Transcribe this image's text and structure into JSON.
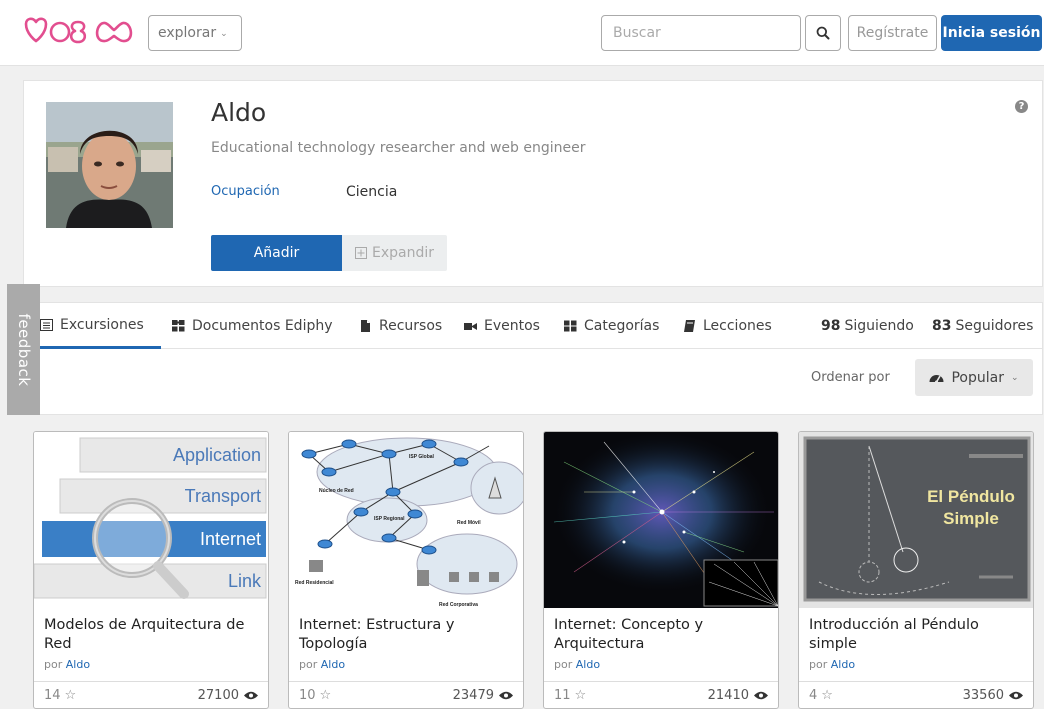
{
  "header": {
    "explore_label": "explorar",
    "search_placeholder": "Buscar",
    "register_label": "Regístrate",
    "login_label": "Inicia sesión",
    "brand_color": "#1f67b2",
    "logo_color": "#e24e8f"
  },
  "profile": {
    "name": "Aldo",
    "description": "Educational technology researcher and web engineer",
    "occupation_label": "Ocupación",
    "occupation_value": "Ciencia",
    "add_label": "Añadir",
    "expand_label": "Expandir"
  },
  "tabs": [
    {
      "label": "Excursiones",
      "icon": "list-icon",
      "active": true
    },
    {
      "label": "Documentos Ediphy",
      "icon": "puzzle-icon",
      "active": false
    },
    {
      "label": "Recursos",
      "icon": "file-icon",
      "active": false
    },
    {
      "label": "Eventos",
      "icon": "video-icon",
      "active": false
    },
    {
      "label": "Categorías",
      "icon": "grid-icon",
      "active": false
    },
    {
      "label": "Lecciones",
      "icon": "book-icon",
      "active": false
    }
  ],
  "stats": {
    "following_count": "98",
    "following_label": "Siguiendo",
    "followers_count": "83",
    "followers_label": "Seguidores"
  },
  "sort": {
    "label": "Ordenar por",
    "value": "Popular"
  },
  "feedback_label": "feedback",
  "cards": [
    {
      "title": "Modelos de Arquitectura de Red",
      "by": "por",
      "author": "Aldo",
      "likes": "14",
      "views": "27100",
      "thumb_labels": [
        "Application",
        "Transport",
        "Internet",
        "Link"
      ]
    },
    {
      "title": "Internet: Estructura y Topología",
      "by": "por",
      "author": "Aldo",
      "likes": "10",
      "views": "23479",
      "thumb_labels": [
        "ISP Global",
        "Núcleo de Red",
        "ISP Regional",
        "Red Móvil",
        "Red Residencial",
        "Red Corporativa"
      ]
    },
    {
      "title": "Internet: Concepto y Arquitectura",
      "by": "por",
      "author": "Aldo",
      "likes": "11",
      "views": "21410"
    },
    {
      "title": "Introducción al Péndulo simple",
      "by": "por",
      "author": "Aldo",
      "likes": "4",
      "views": "33560",
      "thumb_labels": [
        "El Péndulo",
        "Simple"
      ]
    }
  ]
}
